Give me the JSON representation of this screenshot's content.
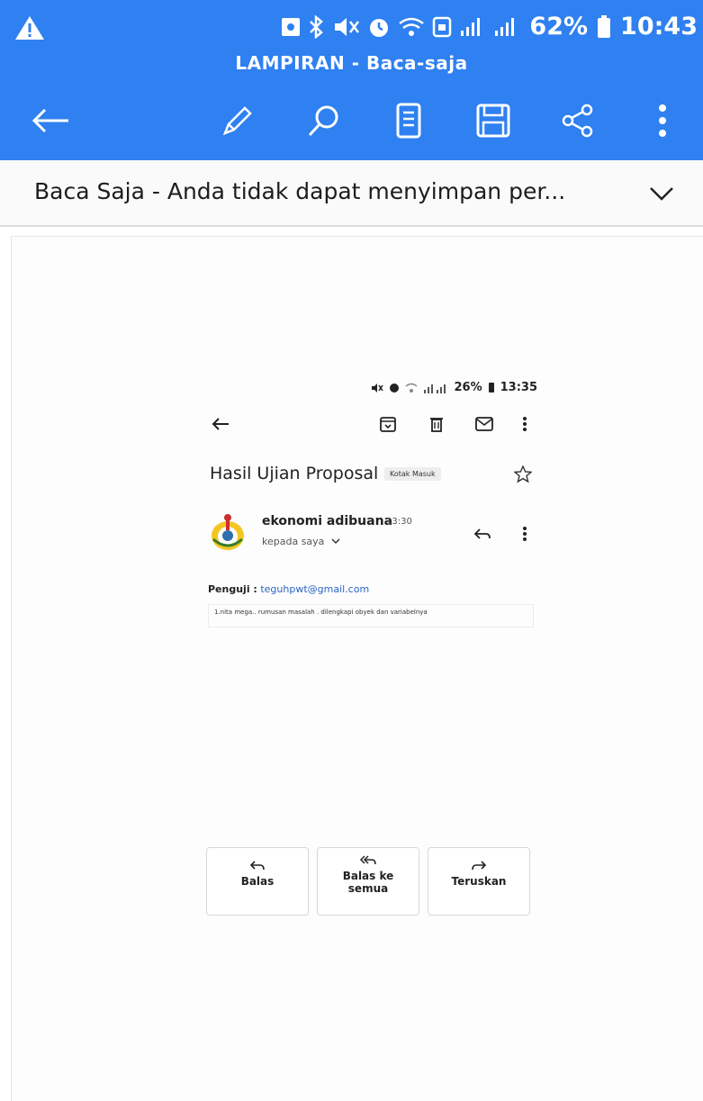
{
  "status_bar": {
    "battery": "62%",
    "time": "10:43"
  },
  "app": {
    "title": "LAMPIRAN - Baca-saja"
  },
  "toolbar": {
    "icons": [
      "back-arrow-icon",
      "pencil-icon",
      "search-icon",
      "document-icon",
      "save-icon",
      "share-icon",
      "more-vertical-icon"
    ]
  },
  "banner": {
    "text": "Baca Saja - Anda tidak dapat menyimpan per..."
  },
  "attachment": {
    "status": {
      "battery": "26%",
      "time": "13:35"
    },
    "email": {
      "subject": "Hasil Ujian Proposal",
      "folder_label": "Kotak Masuk",
      "sender": "ekonomi adibuana",
      "time": "13:30",
      "to": "kepada saya",
      "penguji_label": "Penguji :",
      "penguji_email": "teguhpwt@gmail.com",
      "note": "1.nita mega.. rumusan masalah . dilengkapi obyek dan variabelnya"
    },
    "actions": {
      "reply": "Balas",
      "reply_all_line1": "Balas ke",
      "reply_all_line2": "semua",
      "forward": "Teruskan"
    }
  },
  "colors": {
    "app_bar": "#2f80f0",
    "link": "#2a64c4"
  }
}
